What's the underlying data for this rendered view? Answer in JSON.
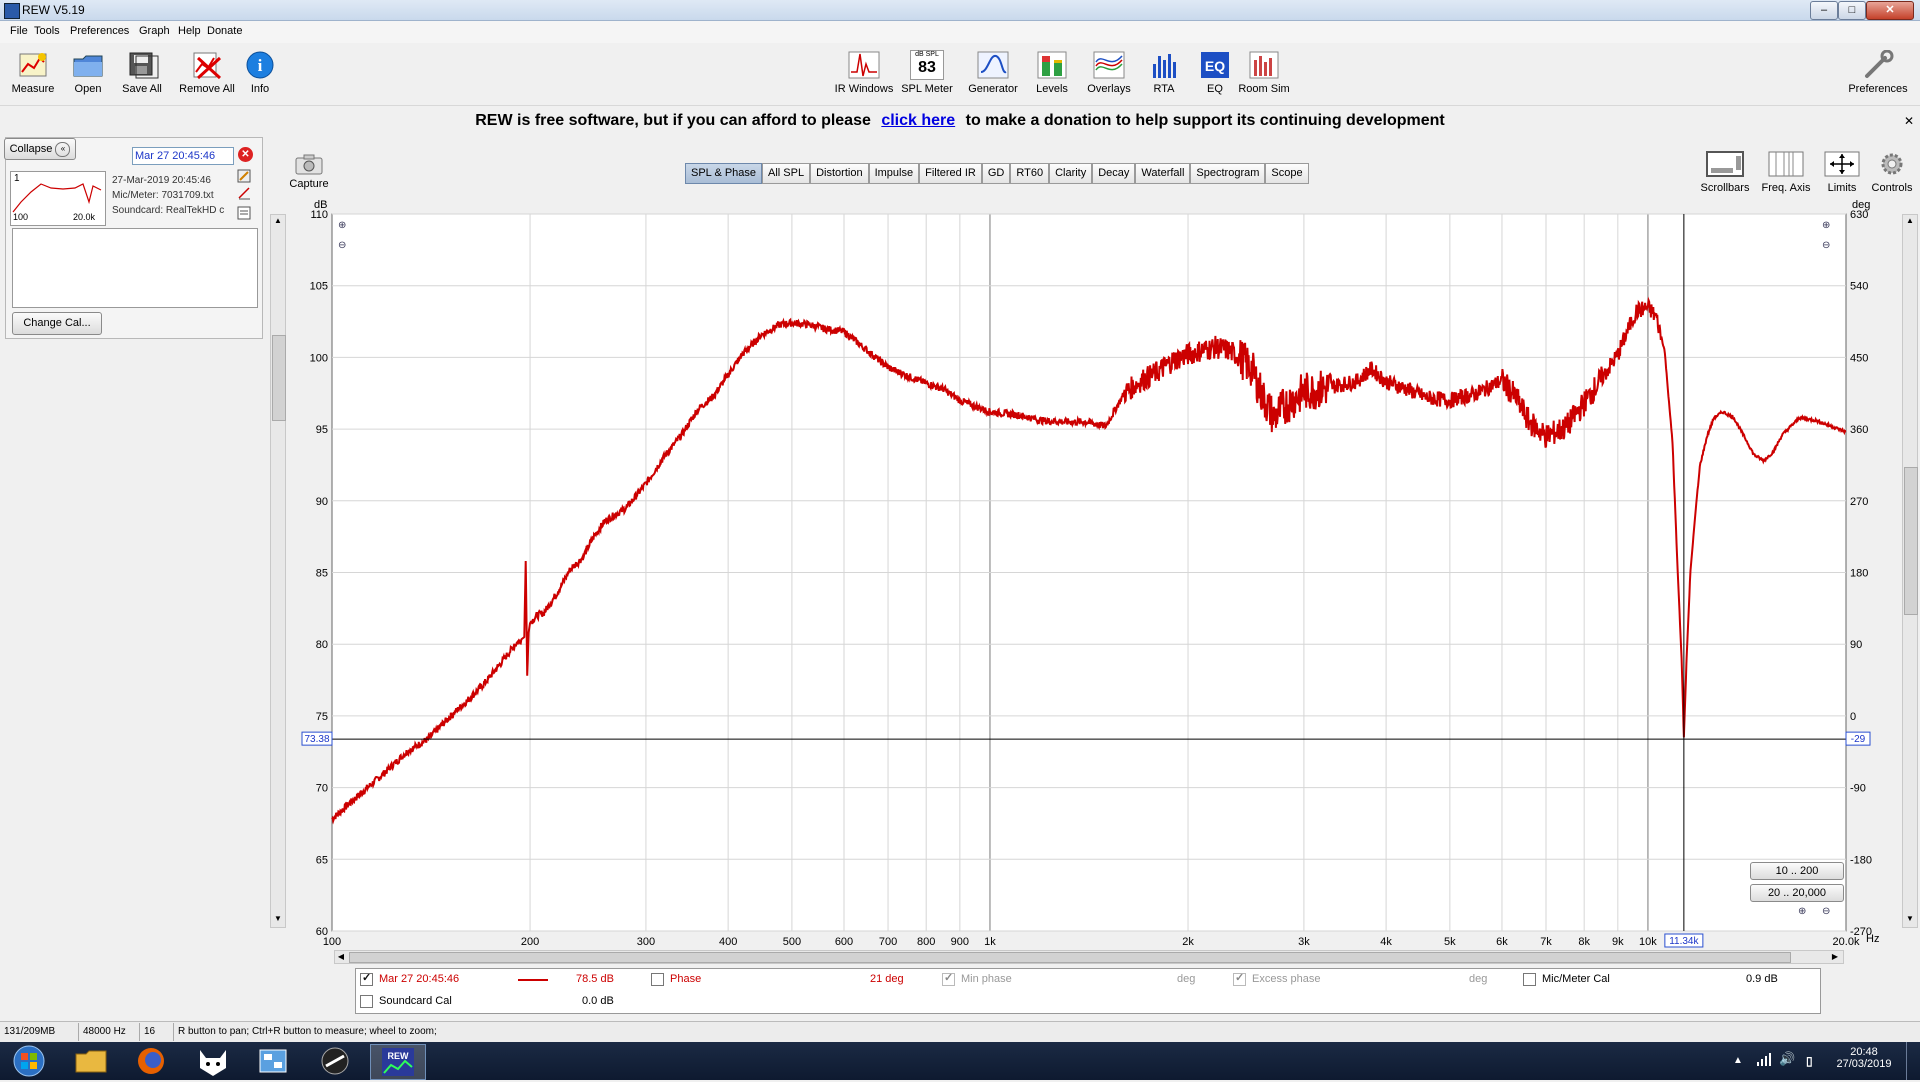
{
  "window": {
    "title": "REW V5.19"
  },
  "menu": [
    "File",
    "Tools",
    "Preferences",
    "Graph",
    "Help",
    "Donate"
  ],
  "toolbar_left": [
    {
      "label": "Measure",
      "icon": "measure-icon"
    },
    {
      "label": "Open",
      "icon": "folder-open-icon"
    },
    {
      "label": "Save All",
      "icon": "save-icon"
    },
    {
      "label": "Remove All",
      "icon": "remove-icon"
    },
    {
      "label": "Info",
      "icon": "info-icon"
    }
  ],
  "toolbar_center": [
    {
      "label": "IR Windows",
      "icon": "ir-windows-icon"
    },
    {
      "label": "SPL Meter",
      "icon": "spl-meter-icon",
      "value": "83",
      "unit": "dB SPL"
    },
    {
      "label": "Generator",
      "icon": "generator-icon"
    },
    {
      "label": "Levels",
      "icon": "levels-icon"
    },
    {
      "label": "Overlays",
      "icon": "overlays-icon"
    },
    {
      "label": "RTA",
      "icon": "rta-icon"
    },
    {
      "label": "EQ",
      "icon": "eq-icon"
    },
    {
      "label": "Room Sim",
      "icon": "room-sim-icon"
    }
  ],
  "toolbar_right": {
    "label": "Preferences",
    "icon": "wrench-icon"
  },
  "donate": {
    "before": "REW is free software, but if you can afford to please",
    "link": "click here",
    "after": "to make a donation to help support its continuing development"
  },
  "left_panel": {
    "collapse_label": "Collapse",
    "measurement_name": "Mar 27 20:45:46",
    "index": "1",
    "thumb_x_min": "100",
    "thumb_x_max": "20.0k",
    "date": "27-Mar-2019 20:45:46",
    "mic_meter": "Mic/Meter: 7031709.txt",
    "soundcard": "Soundcard: RealTekHD c",
    "change_cal_label": "Change Cal..."
  },
  "capture_label": "Capture",
  "graph_tabs": [
    "SPL & Phase",
    "All SPL",
    "Distortion",
    "Impulse",
    "Filtered IR",
    "GD",
    "RT60",
    "Clarity",
    "Decay",
    "Waterfall",
    "Spectrogram",
    "Scope"
  ],
  "graph_controls": [
    {
      "label": "Scrollbars",
      "icon": "scrollbars-icon"
    },
    {
      "label": "Freq. Axis",
      "icon": "freq-axis-icon"
    },
    {
      "label": "Limits",
      "icon": "limits-icon"
    },
    {
      "label": "Controls",
      "icon": "gear-icon"
    }
  ],
  "range_buttons": [
    "10 .. 200",
    "20 .. 20,000"
  ],
  "legend": {
    "row1": {
      "name": "Mar 27 20:45:46",
      "value": "78.5 dB",
      "phase_label": "Phase",
      "phase_value": "21 deg",
      "min_phase_label": "Min phase",
      "min_phase_unit": "deg",
      "excess_phase_label": "Excess phase",
      "excess_phase_unit": "deg",
      "mic_cal_label": "Mic/Meter Cal",
      "mic_cal_value": "0.9 dB"
    },
    "row2": {
      "soundcard_label": "Soundcard Cal",
      "soundcard_value": "0.0 dB"
    }
  },
  "status": {
    "memory": "131/209MB",
    "rate": "48000 Hz",
    "bits": "16 Bit",
    "hint": "R button to pan; Ctrl+R button to measure; wheel to zoom;"
  },
  "clock": {
    "time": "20:48",
    "date": "27/03/2019"
  },
  "chart_data": {
    "type": "line",
    "ylabel": "dB",
    "y2label": "deg",
    "xlabel_unit": "Hz",
    "x_scale": "log",
    "xlim": [
      100,
      20000
    ],
    "ylim": [
      60,
      110
    ],
    "y2lim": [
      -270,
      630
    ],
    "x_ticks": [
      100,
      200,
      300,
      400,
      500,
      600,
      700,
      800,
      900,
      1000,
      2000,
      3000,
      4000,
      5000,
      6000,
      7000,
      8000,
      9000,
      10000,
      20000
    ],
    "x_tick_labels": [
      "100",
      "200",
      "300",
      "400",
      "500",
      "600",
      "700",
      "800",
      "900",
      "1k",
      "2k",
      "3k",
      "4k",
      "5k",
      "6k",
      "7k",
      "8k",
      "9k",
      "10k",
      "20.0k"
    ],
    "y_ticks": [
      60,
      65,
      70,
      75,
      80,
      85,
      90,
      95,
      100,
      105,
      110
    ],
    "y_tick_labels": [
      "60",
      "65",
      "70",
      "75",
      "80",
      "85",
      "90",
      "95",
      "100",
      "105",
      "110"
    ],
    "y2_ticks": [
      -270,
      -180,
      -90,
      0,
      90,
      180,
      270,
      360,
      450,
      540,
      630
    ],
    "y2_tick_labels": [
      "-270",
      "-180",
      "-90",
      "0",
      "90",
      "180",
      "270",
      "360",
      "450",
      "540",
      "630"
    ],
    "cursor": {
      "x": 11340,
      "x_label": "11.34k",
      "y_label": "73.38",
      "y2_label": "-29",
      "y": 73.38
    },
    "series": [
      {
        "name": "Mar 27 20:45:46",
        "color": "#cc0000",
        "x": [
          100,
          110,
          120,
          130,
          140,
          150,
          160,
          170,
          180,
          190,
          196,
          197,
          198,
          199,
          200,
          205,
          210,
          220,
          230,
          240,
          250,
          260,
          280,
          300,
          320,
          340,
          360,
          380,
          400,
          420,
          450,
          480,
          500,
          530,
          560,
          600,
          650,
          700,
          750,
          800,
          850,
          900,
          1000,
          1100,
          1200,
          1300,
          1400,
          1500,
          1600,
          1700,
          1800,
          1900,
          2000,
          2100,
          2200,
          2300,
          2400,
          2500,
          2600,
          2700,
          2800,
          3000,
          3200,
          3400,
          3600,
          3800,
          4000,
          4300,
          4600,
          5000,
          5500,
          6000,
          6300,
          6600,
          7000,
          7500,
          8000,
          8500,
          9000,
          9300,
          9600,
          10000,
          10300,
          10600,
          10900,
          11100,
          11250,
          11340,
          11450,
          11600,
          11800,
          12000,
          12300,
          12600,
          13000,
          13500,
          14000,
          14500,
          15000,
          15500,
          16000,
          17000,
          18000,
          19000,
          20000
        ],
        "y": [
          67.8,
          69.5,
          71,
          72.5,
          73.4,
          74.8,
          76,
          77.2,
          78.6,
          80,
          80.5,
          85.8,
          77.8,
          80.8,
          81.5,
          82,
          82.2,
          83.6,
          85.2,
          86,
          87.5,
          88.6,
          89.5,
          91.2,
          93.1,
          94.6,
          96.4,
          97.3,
          98.8,
          100.2,
          101.6,
          102.3,
          102.4,
          102.3,
          102,
          101.8,
          100.5,
          99.3,
          98.7,
          98.2,
          97.8,
          97,
          96.2,
          96,
          95.6,
          95.5,
          95.5,
          95.2,
          97.5,
          98.4,
          99,
          99.8,
          100.2,
          100.5,
          100.7,
          100.5,
          100,
          99.2,
          97.2,
          95.8,
          96.6,
          97.6,
          97.8,
          98.1,
          98.3,
          99.2,
          98.3,
          97.8,
          97.2,
          97,
          97.5,
          98.4,
          97.2,
          95.5,
          94.5,
          95.1,
          96.8,
          98.5,
          100.2,
          101.8,
          103.2,
          103.5,
          102.8,
          100.5,
          94,
          85,
          79,
          73.5,
          79,
          85,
          89,
          92.5,
          94.5,
          95.8,
          96.2,
          95.8,
          94.5,
          93.2,
          92.8,
          93.4,
          94.6,
          95.8,
          95.6,
          95.2,
          94.8
        ]
      }
    ]
  }
}
